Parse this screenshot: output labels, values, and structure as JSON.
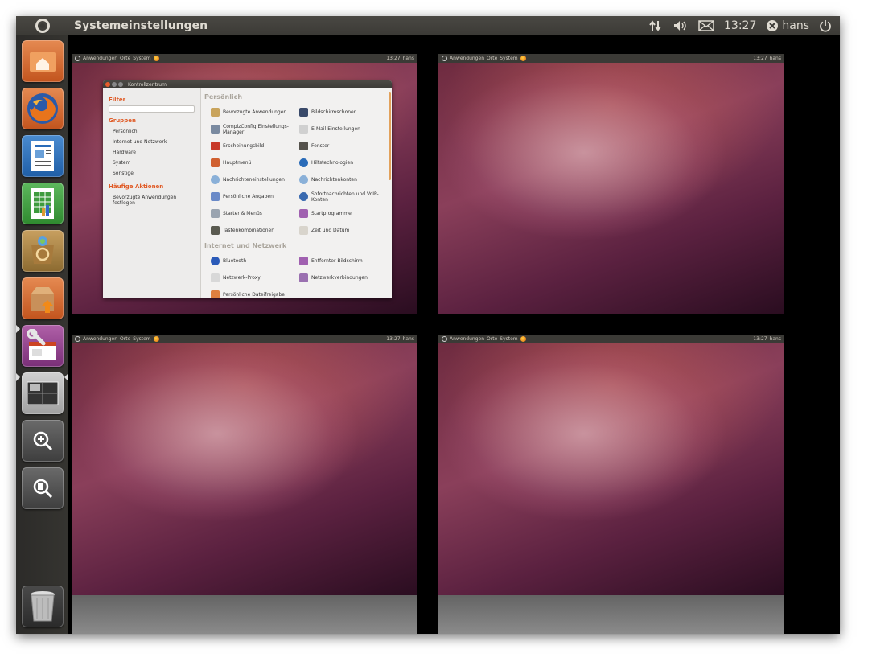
{
  "topbar": {
    "title": "Systemeinstellungen",
    "time": "13:27",
    "user": "hans",
    "icons": [
      "network-icon",
      "volume-icon",
      "mail-icon",
      "session-icon",
      "power-icon"
    ]
  },
  "launcher": {
    "items": [
      {
        "name": "home-folder",
        "icon": "home-folder-icon"
      },
      {
        "name": "firefox",
        "icon": "firefox-icon"
      },
      {
        "name": "libreoffice-writer",
        "icon": "writer-icon"
      },
      {
        "name": "libreoffice-calc",
        "icon": "calc-icon"
      },
      {
        "name": "software-center",
        "icon": "software-center-icon"
      },
      {
        "name": "update-manager",
        "icon": "update-icon"
      },
      {
        "name": "system-settings",
        "icon": "settings-icon"
      },
      {
        "name": "workspace-switcher",
        "icon": "workspaces-icon"
      },
      {
        "name": "applications-lens",
        "icon": "apps-search-icon"
      },
      {
        "name": "files-lens",
        "icon": "files-search-icon"
      },
      {
        "name": "trash",
        "icon": "trash-icon"
      }
    ]
  },
  "mini_panel": {
    "menu_apps": "Anwendungen",
    "menu_places": "Orte",
    "menu_system": "System",
    "time": "13:27",
    "user": "hans"
  },
  "control_center": {
    "title": "Kontrollzentrum",
    "filter_heading": "Filter",
    "groups_heading": "Gruppen",
    "groups": [
      "Persönlich",
      "Internet und Netzwerk",
      "Hardware",
      "System",
      "Sonstige"
    ],
    "actions_heading": "Häufige Aktionen",
    "actions": [
      "Bevorzugte Anwendungen festlegen"
    ],
    "section_personal": "Persönlich",
    "personal_items": [
      "Bevorzugte Anwendungen",
      "Bildschirmschoner",
      "CompizConfig Einstellungs-Manager",
      "E-Mail-Einstellungen",
      "Erscheinungsbild",
      "Fenster",
      "Hauptmenü",
      "Hilfstechnologien",
      "Nachrichteneinstellungen",
      "Nachrichtenkonten",
      "Persönliche Angaben",
      "Sofortnachrichten und VoIP-Konten",
      "Starter & Menüs",
      "Startprogramme",
      "Tastenkombinationen",
      "Zeit und Datum"
    ],
    "section_network": "Internet und Netzwerk",
    "network_items": [
      "Bluetooth",
      "Entfernter Bildschirm",
      "Netzwerk-Proxy",
      "Netzwerkverbindungen"
    ],
    "partial_item": "Persönliche Dateifreigabe"
  },
  "colors": {
    "panel": "#3b3a36",
    "accent": "#e05a25",
    "launcher": "#2c2b29"
  }
}
